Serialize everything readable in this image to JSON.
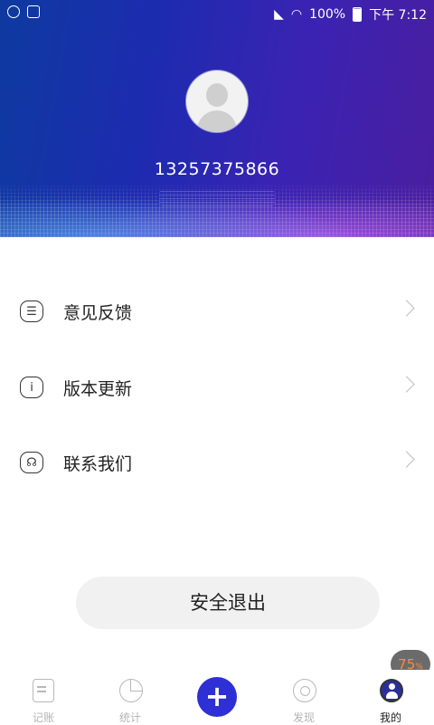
{
  "status_bar": {
    "battery": "100%",
    "time": "下午 7:12"
  },
  "profile": {
    "phone": "13257375866"
  },
  "menu": [
    {
      "label": "意见反馈",
      "icon": "list-icon",
      "icon_glyph": "☰"
    },
    {
      "label": "版本更新",
      "icon": "info-icon",
      "icon_glyph": "i"
    },
    {
      "label": "联系我们",
      "icon": "headset-icon",
      "icon_glyph": "☊"
    }
  ],
  "logout_label": "安全退出",
  "floating_badge": {
    "value": "75",
    "unit": "%"
  },
  "tabs": [
    {
      "label": "记账",
      "icon": "ledger-icon"
    },
    {
      "label": "统计",
      "icon": "pie-chart-icon"
    },
    {
      "label": "",
      "icon": "plus-icon",
      "glyph": "+"
    },
    {
      "label": "发现",
      "icon": "discover-icon"
    },
    {
      "label": "我的",
      "icon": "profile-icon",
      "active": true
    }
  ],
  "colors": {
    "accent": "#2f2fd6",
    "hero_start": "#0e3aa0",
    "hero_end": "#4a1e9f"
  }
}
